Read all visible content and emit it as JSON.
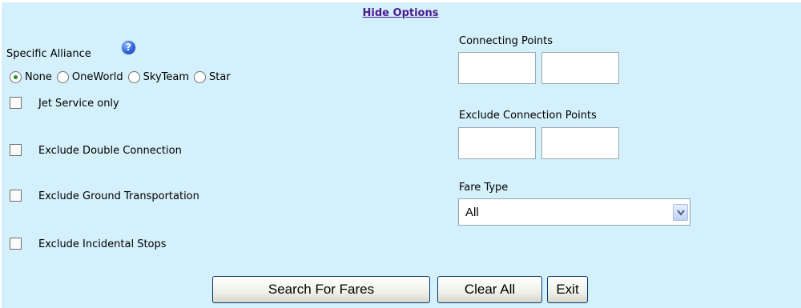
{
  "header": {
    "hide_options": "Hide Options"
  },
  "alliance": {
    "label": "Specific Alliance",
    "help_icon": "question-help-icon",
    "options": [
      "None",
      "OneWorld",
      "SkyTeam",
      "Star"
    ],
    "selected": "None"
  },
  "checkboxes": {
    "jet_service": "Jet Service only",
    "double_connection": "Exclude Double Connection",
    "ground_transport": "Exclude Ground Transportation",
    "incidental_stops": "Exclude Incidental Stops"
  },
  "connecting_points": {
    "label": "Connecting Points"
  },
  "exclude_connection_points": {
    "label": "Exclude Connection Points"
  },
  "fare_type": {
    "label": "Fare Type",
    "selected": "All"
  },
  "buttons": {
    "search": "Search For Fares",
    "clear": "Clear All",
    "exit": "Exit"
  }
}
